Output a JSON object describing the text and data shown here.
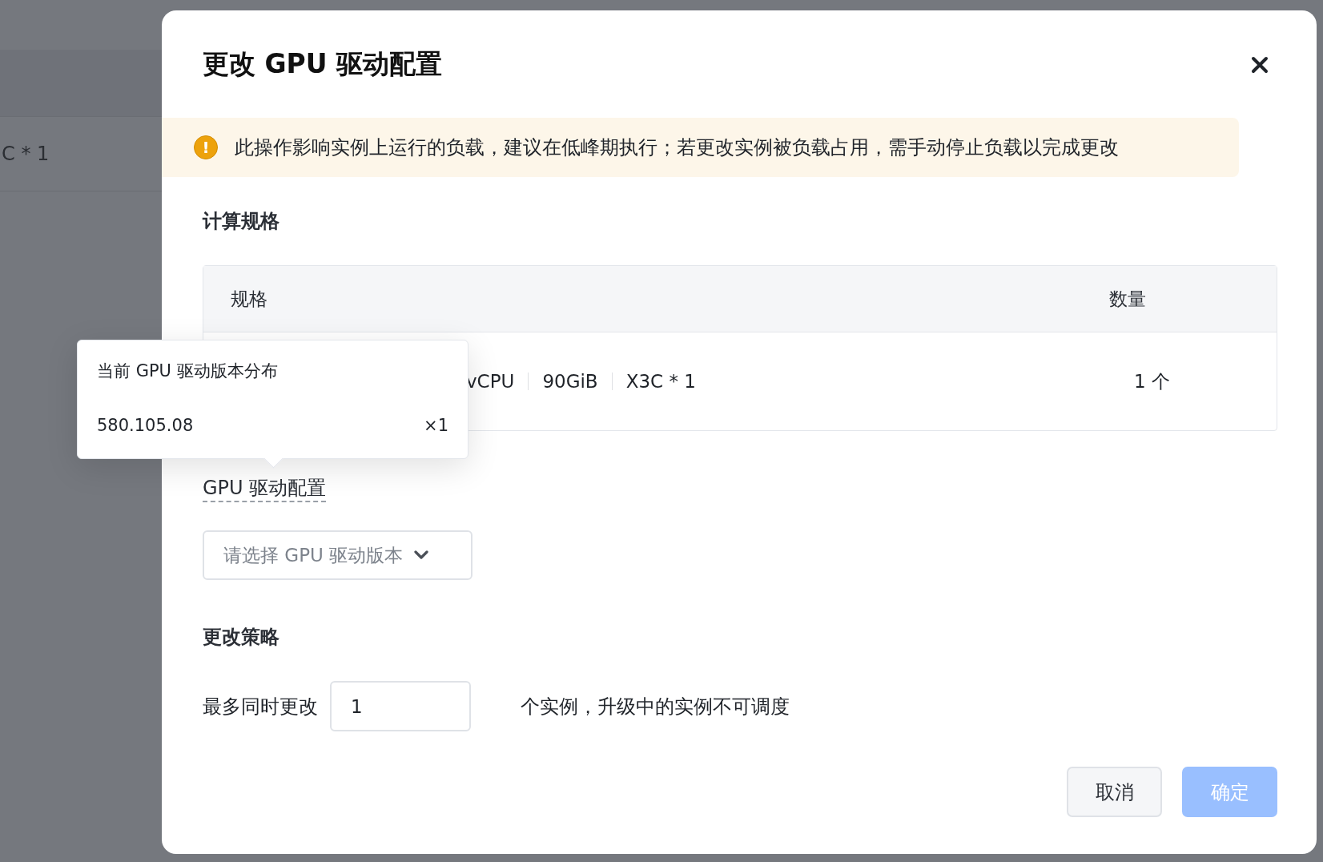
{
  "background": {
    "cell": "C * 1"
  },
  "dialog": {
    "title": "更改 GPU 驱动配置",
    "alert": {
      "icon": "!",
      "text": "此操作影响实例上运行的负载，建议在低峰期执行；若更改实例被负载占用，需手动停止负载以完成更改"
    },
    "compute_section": {
      "title": "计算规格",
      "table": {
        "columns": [
          "规格",
          "数量"
        ],
        "rows": [
          {
            "spec": [
              "vCPU",
              "90GiB",
              "X3C * 1"
            ],
            "count": "1 个"
          }
        ]
      }
    },
    "tooltip": {
      "title": "当前 GPU 驱动版本分布",
      "items": [
        {
          "version": "580.105.08",
          "count": "×1"
        }
      ]
    },
    "driver_section": {
      "label": "GPU 驱动配置",
      "select": {
        "placeholder": "请选择 GPU 驱动版本"
      }
    },
    "strategy_section": {
      "title": "更改策略",
      "prefix": "最多同时更改",
      "value": "1",
      "suffix": "个实例，升级中的实例不可调度"
    },
    "buttons": [
      {
        "label": "取消",
        "kind": "secondary",
        "disabled": false
      },
      {
        "label": "确定",
        "kind": "primary",
        "disabled": true
      }
    ]
  }
}
